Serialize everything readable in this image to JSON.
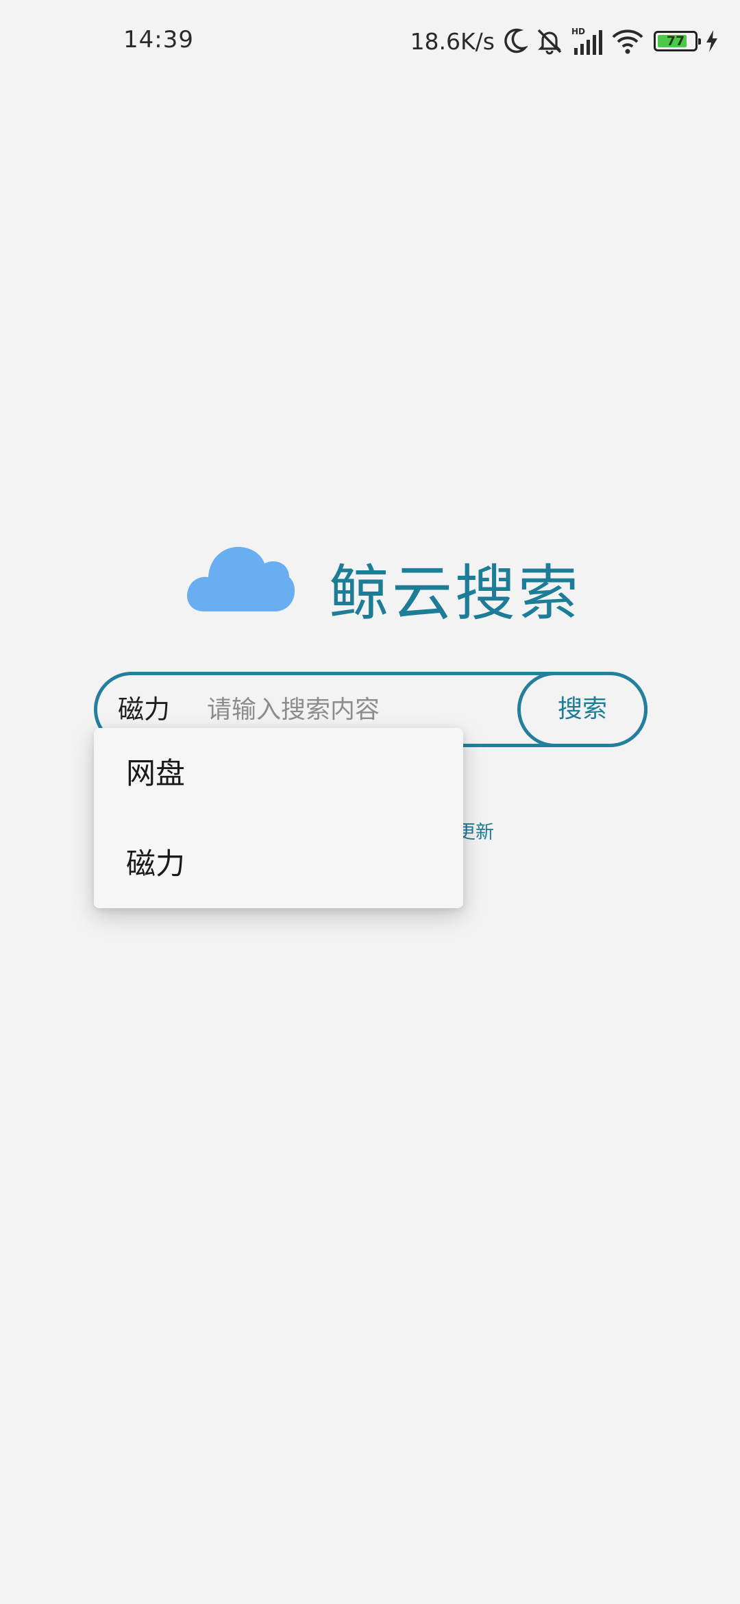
{
  "status_bar": {
    "time": "14:39",
    "net_speed": "18.6K/s",
    "hd_label": "HD",
    "battery_level": "77",
    "icons": [
      "moon-icon",
      "mute-icon",
      "signal-icon",
      "wifi-icon",
      "battery-icon",
      "charging-icon"
    ]
  },
  "logo": {
    "title": "鲸云搜索",
    "icon": "cloud-icon",
    "icon_color": "#6aaef2",
    "title_color": "#1d7d97"
  },
  "search": {
    "type_label": "磁力",
    "placeholder": "请输入搜索内容",
    "value": "",
    "button_label": "搜索",
    "accent_color": "#237f9b"
  },
  "dropdown": {
    "items": [
      {
        "label": "网盘"
      },
      {
        "label": "磁力"
      }
    ]
  },
  "update_link": {
    "visible_text": "查更新"
  }
}
